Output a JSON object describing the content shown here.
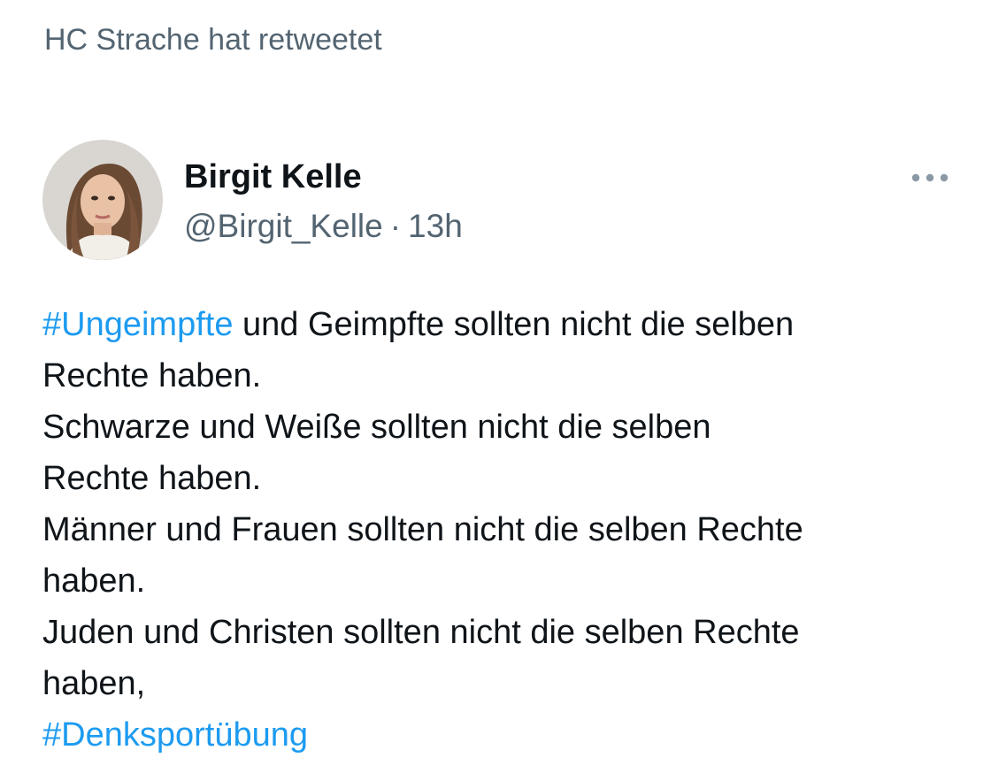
{
  "retweet": {
    "label": "HC Strache hat retweetet"
  },
  "author": {
    "name": "Birgit Kelle",
    "handle": "@Birgit_Kelle",
    "separator": "·",
    "time": "13h",
    "avatar_icon": "profile-photo"
  },
  "more_icon": "more-dots-icon",
  "tweet": {
    "lines": [
      {
        "hashtag": "#Ungeimpfte",
        "text": " und Geimpfte sollten nicht die selben"
      },
      {
        "text": "Rechte haben."
      },
      {
        "text": "Schwarze und Weiße sollten nicht die selben"
      },
      {
        "text": "Rechte haben."
      },
      {
        "text": "Männer und Frauen sollten nicht die selben Rechte"
      },
      {
        "text": "haben."
      },
      {
        "text": "Juden und Christen sollten nicht die selben Rechte"
      },
      {
        "text": "haben,"
      },
      {
        "hashtag": "#Denksportübung"
      }
    ]
  },
  "colors": {
    "link": "#1d9bf0",
    "secondary_text": "#536471",
    "primary_text": "#0f1419"
  }
}
